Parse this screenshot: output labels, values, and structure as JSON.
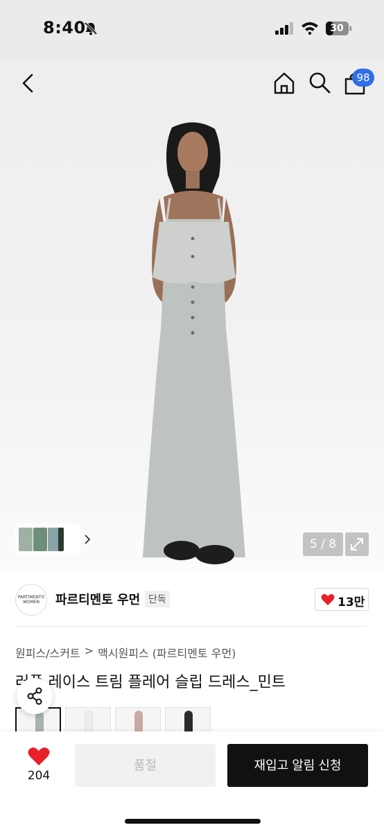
{
  "status_bar": {
    "time": "8:40",
    "battery": "30"
  },
  "header": {
    "cart_count": "98"
  },
  "gallery": {
    "counter": "5 / 8"
  },
  "brand": {
    "logo_text": "PARTIMENTO WOMEN",
    "name": "파르티멘토 우먼",
    "tag": "단독",
    "like_count": "13만"
  },
  "breadcrumb": {
    "category": "원피스/스커트",
    "separator": ">",
    "subcategory": "맥시원피스 (파르티멘토 우먼)"
  },
  "product": {
    "title": "러플 레이스 트림 플레어 슬립 드레스_민트"
  },
  "color_options": [
    {
      "label": "mint",
      "color": "#a9b3ad"
    },
    {
      "label": "white",
      "color": "#ececec"
    },
    {
      "label": "pink",
      "color": "#c9a9a3"
    },
    {
      "label": "black",
      "color": "#2a2a2a"
    }
  ],
  "bottom_bar": {
    "like_count": "204",
    "soldout_label": "품절",
    "restock_label": "재입고 알림 신청"
  },
  "colors": {
    "accent_blue": "#2f6fe6",
    "heart_red": "#e8202a",
    "primary_black": "#111111"
  }
}
